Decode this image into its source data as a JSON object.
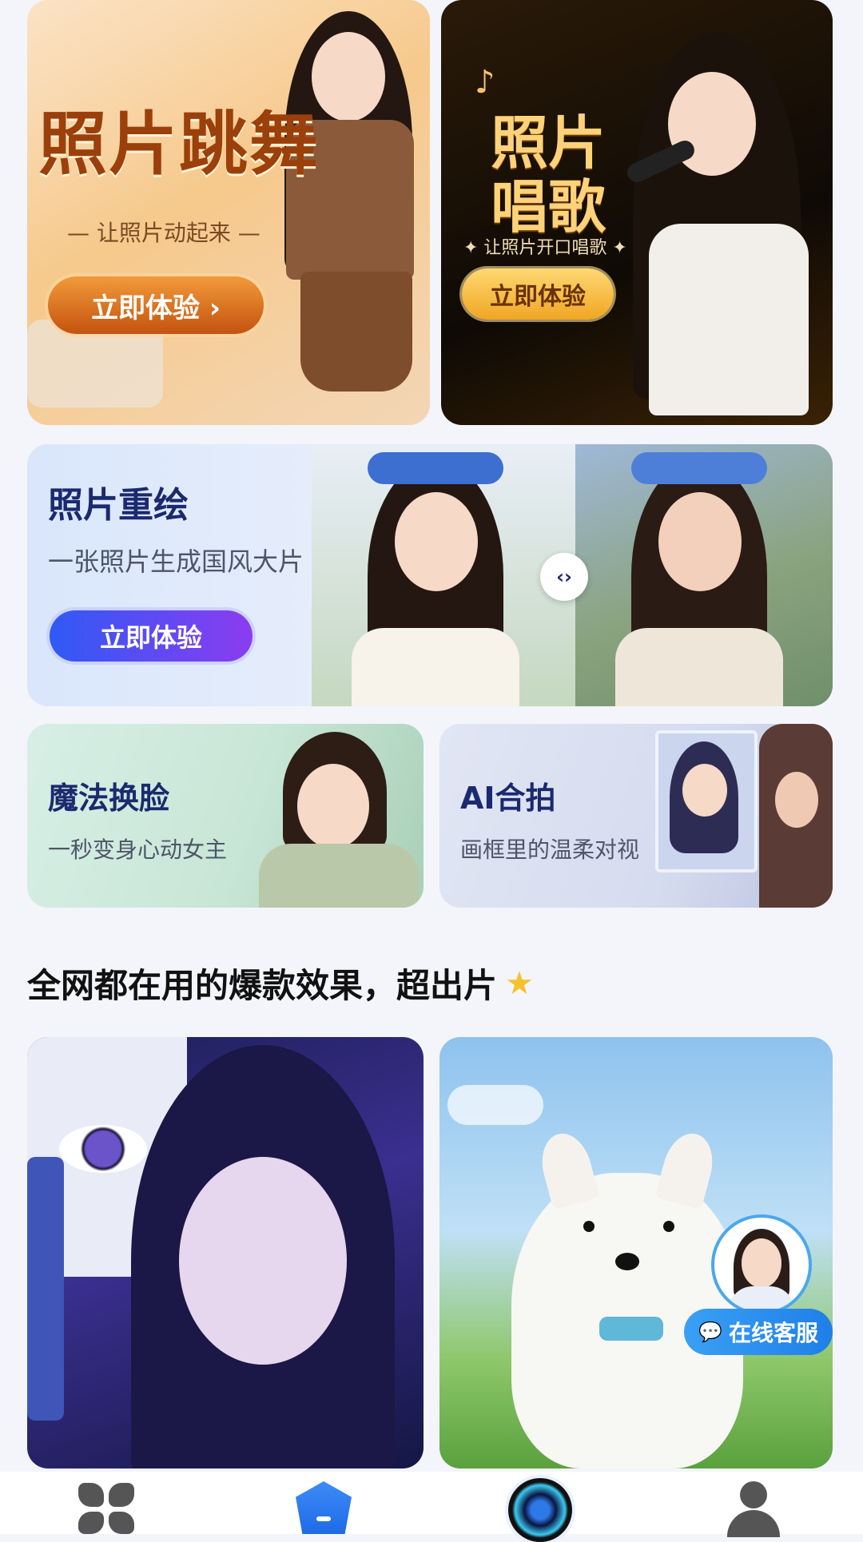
{
  "cards": {
    "photo_dance": {
      "title": "照片跳舞",
      "subtitle": "— 让照片动起来 —",
      "button": "立即体验 ›"
    },
    "photo_sing": {
      "title_line1": "照片",
      "title_line2": "唱歌",
      "subtitle": "✦ 让照片开口唱歌 ✦",
      "button": "立即体验"
    },
    "photo_redraw": {
      "title": "照片重绘",
      "subtitle": "一张照片生成国风大片",
      "button": "立即体验",
      "compare_handle": "‹›"
    },
    "magic_face_swap": {
      "title": "魔法换脸",
      "subtitle": "一秒变身心动女主"
    },
    "ai_group_photo": {
      "title": "AI合拍",
      "subtitle": "画框里的温柔对视"
    }
  },
  "section": {
    "title": "全网都在用的爆款效果，超出片",
    "icon": "star-icon"
  },
  "customer_service": {
    "label": "在线客服",
    "icon": "wechat-icon"
  },
  "bottom_nav": {
    "items": [
      {
        "icon": "apps-icon"
      },
      {
        "icon": "shield-icon"
      },
      {
        "icon": "camera-lens-icon"
      },
      {
        "icon": "person-icon"
      }
    ]
  },
  "colors": {
    "accent_blue": "#2f5af5",
    "accent_purple": "#8b3cf0",
    "orange": "#d9661a",
    "gold": "#f5b83a"
  }
}
